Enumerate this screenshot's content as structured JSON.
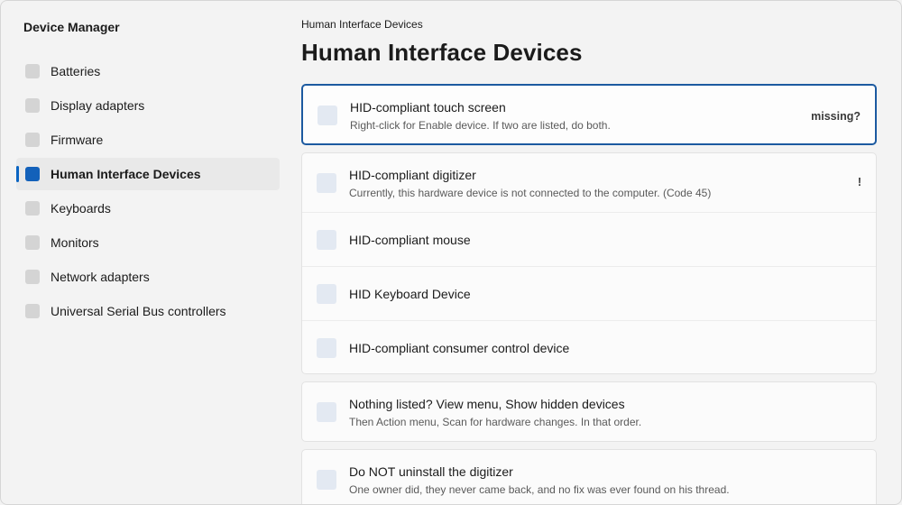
{
  "app": {
    "title": "Device Manager"
  },
  "sidebar": {
    "items": [
      {
        "label": "Batteries",
        "selected": false
      },
      {
        "label": "Display adapters",
        "selected": false
      },
      {
        "label": "Firmware",
        "selected": false
      },
      {
        "label": "Human Interface Devices",
        "selected": true
      },
      {
        "label": "Keyboards",
        "selected": false
      },
      {
        "label": "Monitors",
        "selected": false
      },
      {
        "label": "Network adapters",
        "selected": false
      },
      {
        "label": "Universal Serial Bus controllers",
        "selected": false
      }
    ]
  },
  "main": {
    "breadcrumb": "Human Interface Devices",
    "title": "Human Interface Devices",
    "highlight_card": {
      "title": "HID-compliant touch screen",
      "subtitle": "Right-click for Enable device. If two are listed, do both.",
      "badge": "missing?"
    },
    "device_list": [
      {
        "title": "HID-compliant digitizer",
        "subtitle": "Currently, this hardware device is not connected to the computer. (Code 45)",
        "badge": "!"
      },
      {
        "title": "HID-compliant mouse"
      },
      {
        "title": "HID Keyboard Device"
      },
      {
        "title": "HID-compliant consumer control device"
      }
    ],
    "tip_cards": [
      {
        "title": "Nothing listed? View menu, Show hidden devices",
        "subtitle": "Then Action menu, Scan for hardware changes. In that order."
      },
      {
        "title": "Do NOT uninstall the digitizer",
        "subtitle": "One owner did, they never came back, and no fix was ever found on his thread."
      }
    ]
  },
  "colors": {
    "accent": "#0a64c2",
    "selected_icon": "#1361ba",
    "highlight_border": "#1c5aa0",
    "window_bg": "#f3f3f3"
  }
}
